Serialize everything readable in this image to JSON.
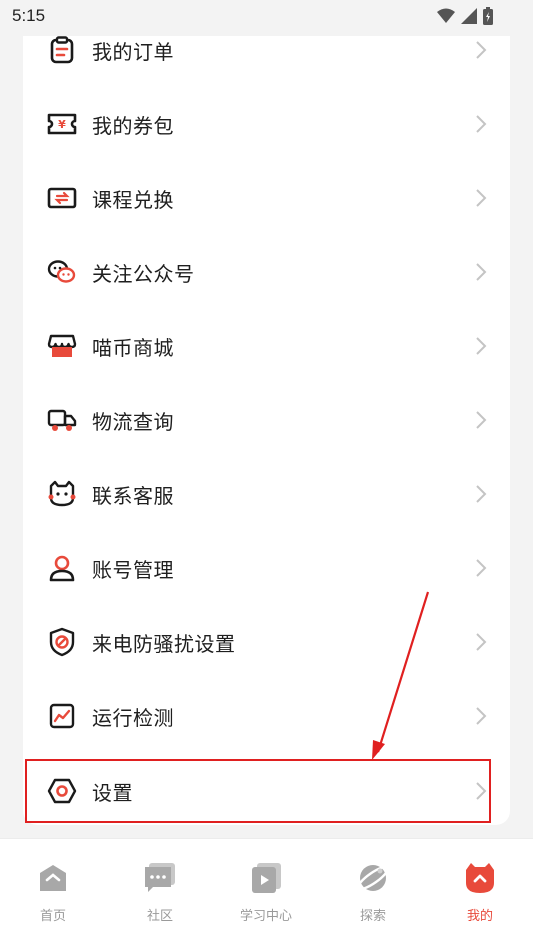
{
  "status_bar": {
    "time": "5:15"
  },
  "menu": {
    "items": [
      {
        "label": "我的订单",
        "icon": "clipboard-icon"
      },
      {
        "label": "我的券包",
        "icon": "coupon-icon"
      },
      {
        "label": "课程兑换",
        "icon": "exchange-icon"
      },
      {
        "label": "关注公众号",
        "icon": "wechat-icon"
      },
      {
        "label": "喵币商城",
        "icon": "store-icon"
      },
      {
        "label": "物流查询",
        "icon": "truck-icon"
      },
      {
        "label": "联系客服",
        "icon": "customer-service-icon"
      },
      {
        "label": "账号管理",
        "icon": "user-icon"
      },
      {
        "label": "来电防骚扰设置",
        "icon": "shield-icon"
      },
      {
        "label": "运行检测",
        "icon": "monitor-icon"
      },
      {
        "label": "设置",
        "icon": "settings-icon"
      }
    ]
  },
  "tabbar": {
    "tabs": [
      {
        "label": "首页",
        "icon": "home-icon",
        "active": false
      },
      {
        "label": "社区",
        "icon": "chat-icon",
        "active": false
      },
      {
        "label": "学习中心",
        "icon": "play-icon",
        "active": false
      },
      {
        "label": "探索",
        "icon": "planet-icon",
        "active": false
      },
      {
        "label": "我的",
        "icon": "cat-icon",
        "active": true
      }
    ]
  },
  "colors": {
    "accent": "#e84a3b",
    "annotation": "#e02020",
    "icon_dark": "#1a1a1a",
    "tab_inactive": "#9a9a9a"
  }
}
